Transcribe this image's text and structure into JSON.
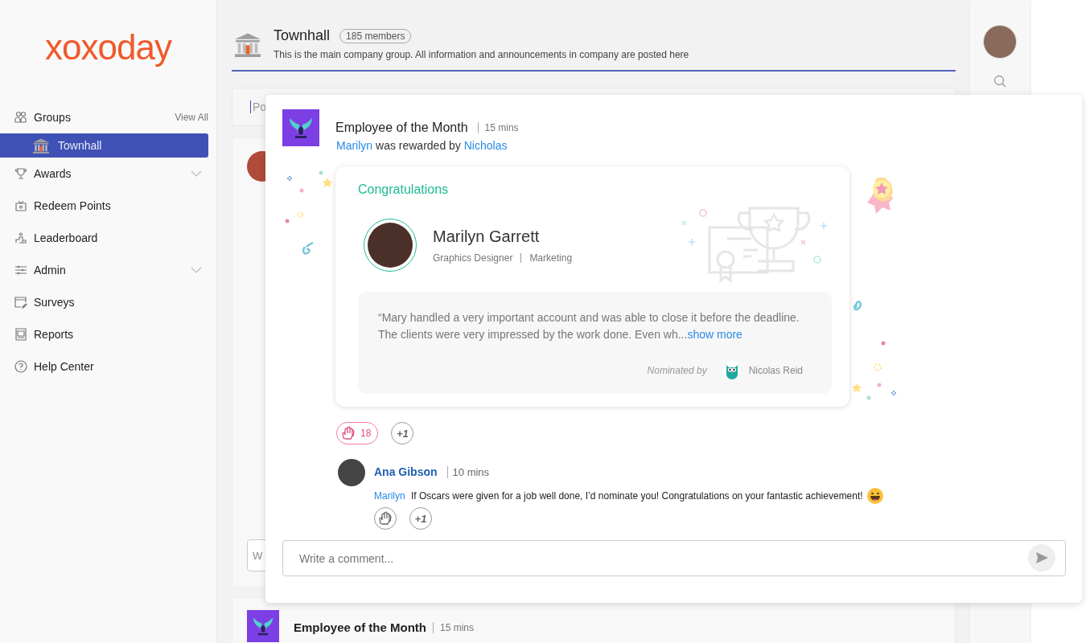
{
  "sidebar": {
    "logo": "xoxoday",
    "groups_label": "Groups",
    "view_all": "View All",
    "groups": [
      {
        "label": "Townhall",
        "selected": true
      }
    ],
    "items": [
      {
        "label": "Awards",
        "kind": "trophy",
        "expandable": true
      },
      {
        "label": "Redeem Points",
        "kind": "gift",
        "expandable": false
      },
      {
        "label": "Leaderboard",
        "kind": "podium",
        "expandable": false
      },
      {
        "label": "Admin",
        "kind": "sliders",
        "expandable": true
      },
      {
        "label": "Surveys",
        "kind": "survey",
        "expandable": false
      },
      {
        "label": "Reports",
        "kind": "report",
        "expandable": false
      },
      {
        "label": "Help Center",
        "kind": "help",
        "expandable": false
      }
    ]
  },
  "header": {
    "title": "Townhall",
    "members": "185 members",
    "description": "This is the main company group. All information and announcements in company are posted here"
  },
  "feed": {
    "post_placeholder": "Po",
    "comment_placeholder": "W",
    "next_post": {
      "title": "Employee of the Month",
      "time": "15 mins"
    }
  },
  "popup": {
    "title": "Employee of the Month",
    "time": "15 mins",
    "recipient": "Marilyn",
    "reward_text": "was rewarded by",
    "giver": "Nicholas",
    "card": {
      "heading": "Congratulations",
      "name": "Marilyn Garrett",
      "role": "Graphics Designer",
      "department": "Marketing",
      "quote": "“Mary handled a very important account and was able to close it before the deadline. The clients were very impressed by the work done. Even wh...",
      "show_more": "show more",
      "nominated_label": "Nominated by",
      "nominator": "Nicolas Reid"
    },
    "reactions": [
      {
        "kind": "clap",
        "count": "18",
        "selected": true
      },
      {
        "kind": "plus",
        "label": "+1",
        "selected": false
      }
    ],
    "comment": {
      "author": "Ana Gibson",
      "time": "10 mins",
      "mention": "Marilyn",
      "text": "If Oscars were given for a job well done, I’d nominate you! Congratulations on your fantastic achievement!",
      "reactions": [
        {
          "kind": "clap",
          "selected": false
        },
        {
          "kind": "plus",
          "label": "+1",
          "selected": false
        }
      ]
    },
    "comment_placeholder": "Write a comment..."
  }
}
